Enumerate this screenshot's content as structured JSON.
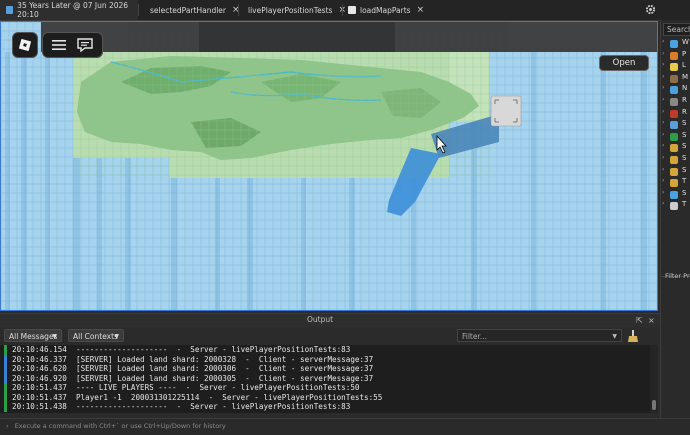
{
  "tabs": [
    {
      "label": "35 Years Later @ 07 Jun 2026 20:10",
      "icon": "roblox-place-icon",
      "active": true
    },
    {
      "label": "selectedPartHandler",
      "icon": "script-icon",
      "active": false
    },
    {
      "label": "livePlayerPositionTests",
      "icon": "script-icon",
      "active": false
    },
    {
      "label": "loadMapParts",
      "icon": "script-icon",
      "active": false
    }
  ],
  "tab_close_glyph": "×",
  "viewport": {
    "open_button": "Open",
    "roblox_menu_icon": "roblox-logo-icon",
    "menu_icon": "hamburger-icon",
    "chat_icon": "chat-icon"
  },
  "output": {
    "title": "Output",
    "messages_filter": "All Messages",
    "contexts_filter": "All Contexts",
    "filter_placeholder": "Filter...",
    "lines": [
      {
        "text": "20:10:46.154  --------------------  -  Server - livePlayerPositionTests:83",
        "color": "#2e9e46"
      },
      {
        "text": "20:10:46.337  [SERVER] Loaded land shard: 2000328  -  Client - serverMessage:37",
        "color": "#3b7fd6"
      },
      {
        "text": "20:10:46.620  [SERVER] Loaded land shard: 2000306  -  Client - serverMessage:37",
        "color": "#3b7fd6"
      },
      {
        "text": "20:10:46.920  [SERVER] Loaded land shard: 2000305  -  Client - serverMessage:37",
        "color": "#3b7fd6"
      },
      {
        "text": "20:10:51.437  ---- LIVE PLAYERS ----  -  Server - livePlayerPositionTests:50",
        "color": "#2e9e46"
      },
      {
        "text": "20:10:51.437  Player1 -1  200031301225114  -  Server - livePlayerPositionTests:55",
        "color": "#2e9e46"
      },
      {
        "text": "20:10:51.438  --------------------  -  Server - livePlayerPositionTests:83",
        "color": "#2e9e46"
      }
    ]
  },
  "command_bar": {
    "placeholder": "Execute a command with Ctrl+` or use Ctrl+Up/Down for history"
  },
  "explorer": {
    "search_label": "Search",
    "filter_properties_label": "Filter Pro",
    "items": [
      {
        "label": "W",
        "icon": "workspace-icon",
        "color": "#4aa3df"
      },
      {
        "label": "P",
        "icon": "players-icon",
        "color": "#d97d2a"
      },
      {
        "label": "L",
        "icon": "lighting-icon",
        "color": "#e8c94a"
      },
      {
        "label": "M",
        "icon": "material-icon",
        "color": "#8b6f4a"
      },
      {
        "label": "N",
        "icon": "network-icon",
        "color": "#4aa3df"
      },
      {
        "label": "R",
        "icon": "replicated-first-icon",
        "color": "#888888"
      },
      {
        "label": "R",
        "icon": "replicated-storage-icon",
        "color": "#c0392b"
      },
      {
        "label": "S",
        "icon": "server-script-service-icon",
        "color": "#5aa0d8"
      },
      {
        "label": "S",
        "icon": "server-storage-icon",
        "color": "#2e9e46"
      },
      {
        "label": "S",
        "icon": "starter-gui-icon",
        "color": "#d4a53a"
      },
      {
        "label": "S",
        "icon": "starter-pack-icon",
        "color": "#d4a53a"
      },
      {
        "label": "S",
        "icon": "starter-player-icon",
        "color": "#d4a53a"
      },
      {
        "label": "T",
        "icon": "teams-icon",
        "color": "#d4a53a"
      },
      {
        "label": "S",
        "icon": "sound-service-icon",
        "color": "#4aa3df"
      },
      {
        "label": "T",
        "icon": "text-chat-service-icon",
        "color": "#cccccc"
      }
    ]
  }
}
